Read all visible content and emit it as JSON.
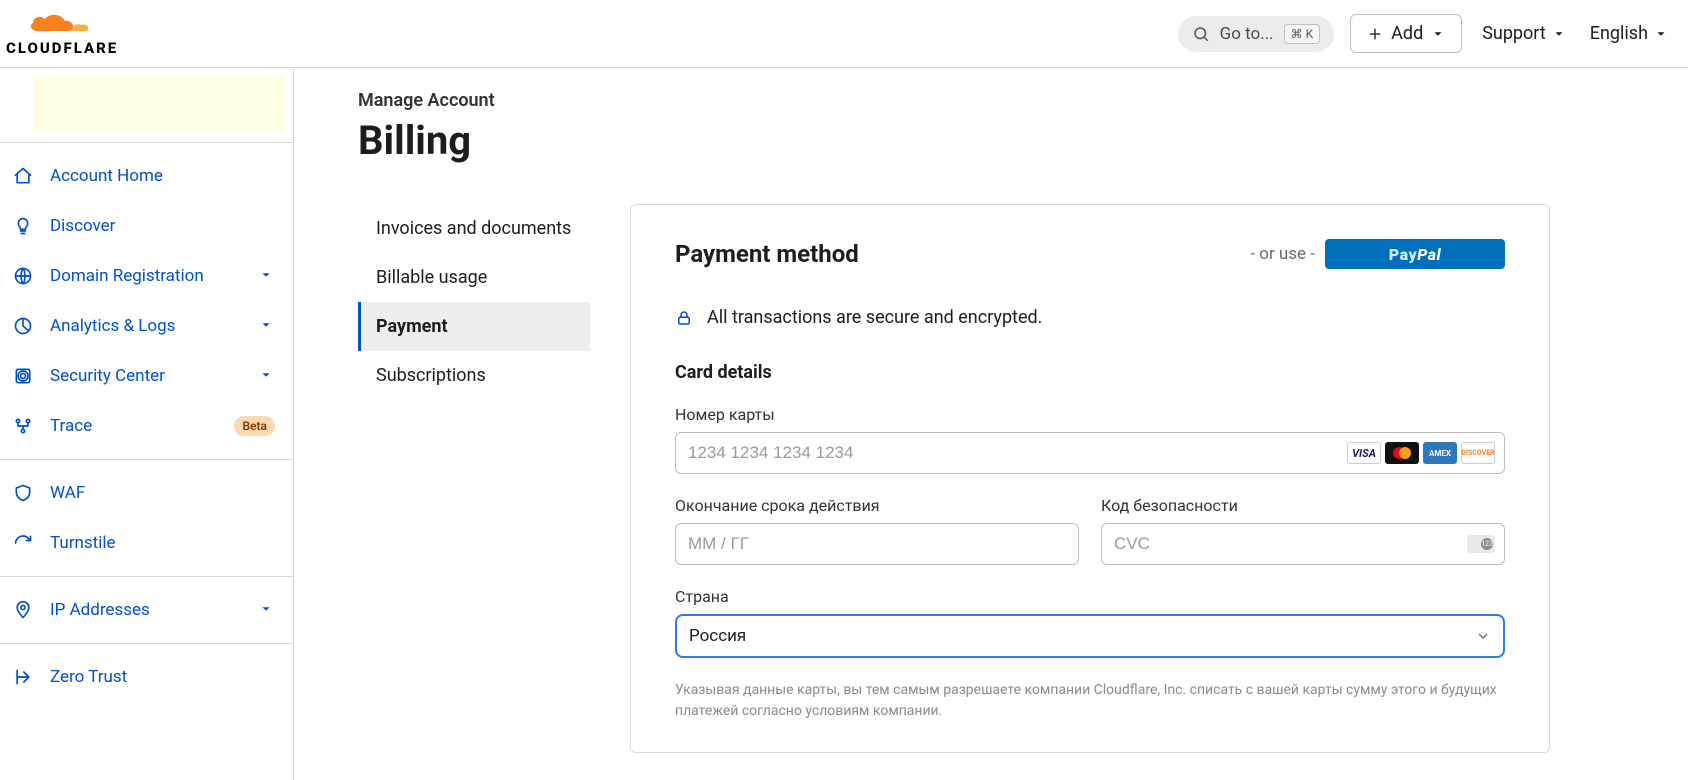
{
  "header": {
    "brand": "CLOUDFLARE",
    "search_label": "Go to...",
    "search_kbd": "⌘ K",
    "add_label": "Add",
    "menu_support": "Support",
    "menu_language": "English"
  },
  "sidebar": {
    "items": [
      {
        "icon": "home",
        "label": "Account Home",
        "expandable": false
      },
      {
        "icon": "bulb",
        "label": "Discover",
        "expandable": false
      },
      {
        "icon": "globe",
        "label": "Domain Registration",
        "expandable": true
      },
      {
        "icon": "chart",
        "label": "Analytics & Logs",
        "expandable": true
      },
      {
        "icon": "scan",
        "label": "Security Center",
        "expandable": true
      },
      {
        "icon": "trace",
        "label": "Trace",
        "expandable": false,
        "badge": "Beta"
      }
    ],
    "items2": [
      {
        "icon": "shield",
        "label": "WAF"
      },
      {
        "icon": "refresh",
        "label": "Turnstile"
      }
    ],
    "items3": [
      {
        "icon": "pin",
        "label": "IP Addresses",
        "expandable": true
      }
    ],
    "items4": [
      {
        "icon": "arrowout",
        "label": "Zero Trust"
      }
    ]
  },
  "page": {
    "breadcrumb": "Manage Account",
    "title": "Billing",
    "tabs": [
      "Invoices and documents",
      "Billable usage",
      "Payment",
      "Subscriptions"
    ],
    "active_tab": 2
  },
  "panel": {
    "title": "Payment method",
    "or_use": "- or use -",
    "paypal": "PayPal",
    "secure_text": "All transactions are secure and encrypted.",
    "section_title": "Card details",
    "card_number_label": "Номер карты",
    "card_number_placeholder": "1234 1234 1234 1234",
    "expiry_label": "Окончание срока действия",
    "expiry_placeholder": "ММ / ГГ",
    "cvc_label": "Код безопасности",
    "cvc_placeholder": "CVC",
    "country_label": "Страна",
    "country_value": "Россия",
    "legal": "Указывая данные карты, вы тем самым разрешаете компании Cloudflare, Inc. списать с вашей карты сумму этого и будущих платежей согласно условиям компании."
  }
}
